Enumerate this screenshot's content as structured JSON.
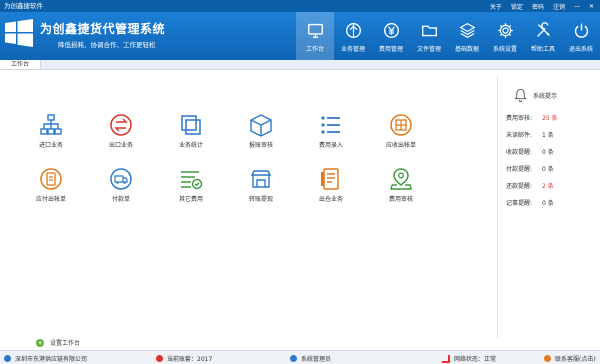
{
  "window": {
    "title": "为创鑫捷软件",
    "links": [
      "关于",
      "锁定",
      "密码",
      "注销",
      "—",
      "✕"
    ]
  },
  "header": {
    "app_title": "为创鑫捷货代管理系统",
    "slogan": "降低损耗、协调合作、工作更轻松"
  },
  "nav": [
    {
      "label": "工作台",
      "icon": "monitor-icon",
      "active": true
    },
    {
      "label": "业务管理",
      "icon": "compass-icon"
    },
    {
      "label": "费用管理",
      "icon": "yen-icon"
    },
    {
      "label": "文件管理",
      "icon": "folder-icon"
    },
    {
      "label": "基础数据",
      "icon": "layers-icon"
    },
    {
      "label": "系统设置",
      "icon": "gear-icon"
    },
    {
      "label": "帮助工具",
      "icon": "tools-icon"
    },
    {
      "label": "退出系统",
      "icon": "power-icon"
    }
  ],
  "tabs": [
    {
      "label": "工作台"
    }
  ],
  "tiles": [
    {
      "label": "进口业务",
      "icon": "import-icon"
    },
    {
      "label": "出口业务",
      "icon": "export-icon"
    },
    {
      "label": "业务统计",
      "icon": "statistics-icon"
    },
    {
      "label": "报账审核",
      "icon": "box-audit-icon"
    },
    {
      "label": "费用录入",
      "icon": "list-entry-icon"
    },
    {
      "label": "应收出帐单",
      "icon": "receivable-icon"
    },
    {
      "label": "应付出帐单",
      "icon": "payable-icon"
    },
    {
      "label": "付款单",
      "icon": "payment-truck-icon"
    },
    {
      "label": "其它费用",
      "icon": "other-fees-icon"
    },
    {
      "label": "转账提现",
      "icon": "transfer-icon"
    },
    {
      "label": "出仓业务",
      "icon": "warehouse-out-icon"
    },
    {
      "label": "费用审核",
      "icon": "fee-audit-icon"
    }
  ],
  "tips": {
    "title": "系统提示",
    "rows": [
      {
        "label": "费用审核:",
        "value": "25 条",
        "highlight": true
      },
      {
        "label": "未读邮件:",
        "value": "1 条",
        "highlight": false
      },
      {
        "label": "收款提醒:",
        "value": "0 条",
        "highlight": false
      },
      {
        "label": "付款提醒:",
        "value": "0 条",
        "highlight": false
      },
      {
        "label": "还款提醒:",
        "value": "2 条",
        "highlight": true
      },
      {
        "label": "记事提醒:",
        "value": "0 条",
        "highlight": false
      }
    ]
  },
  "add_desk": {
    "label": "设置工作台"
  },
  "status": {
    "company": "深圳市东港供应链有限公司",
    "account": "当前账套：2017",
    "user": "系统管理员",
    "network": "网络状态：正常",
    "contact": "联系客服(点击)"
  },
  "colors": {
    "header": "#1677cf",
    "accent_red": "#e0312b",
    "icon_blue": "#2b79c9",
    "icon_orange": "#e07a1c",
    "icon_green": "#3e9b3e"
  }
}
